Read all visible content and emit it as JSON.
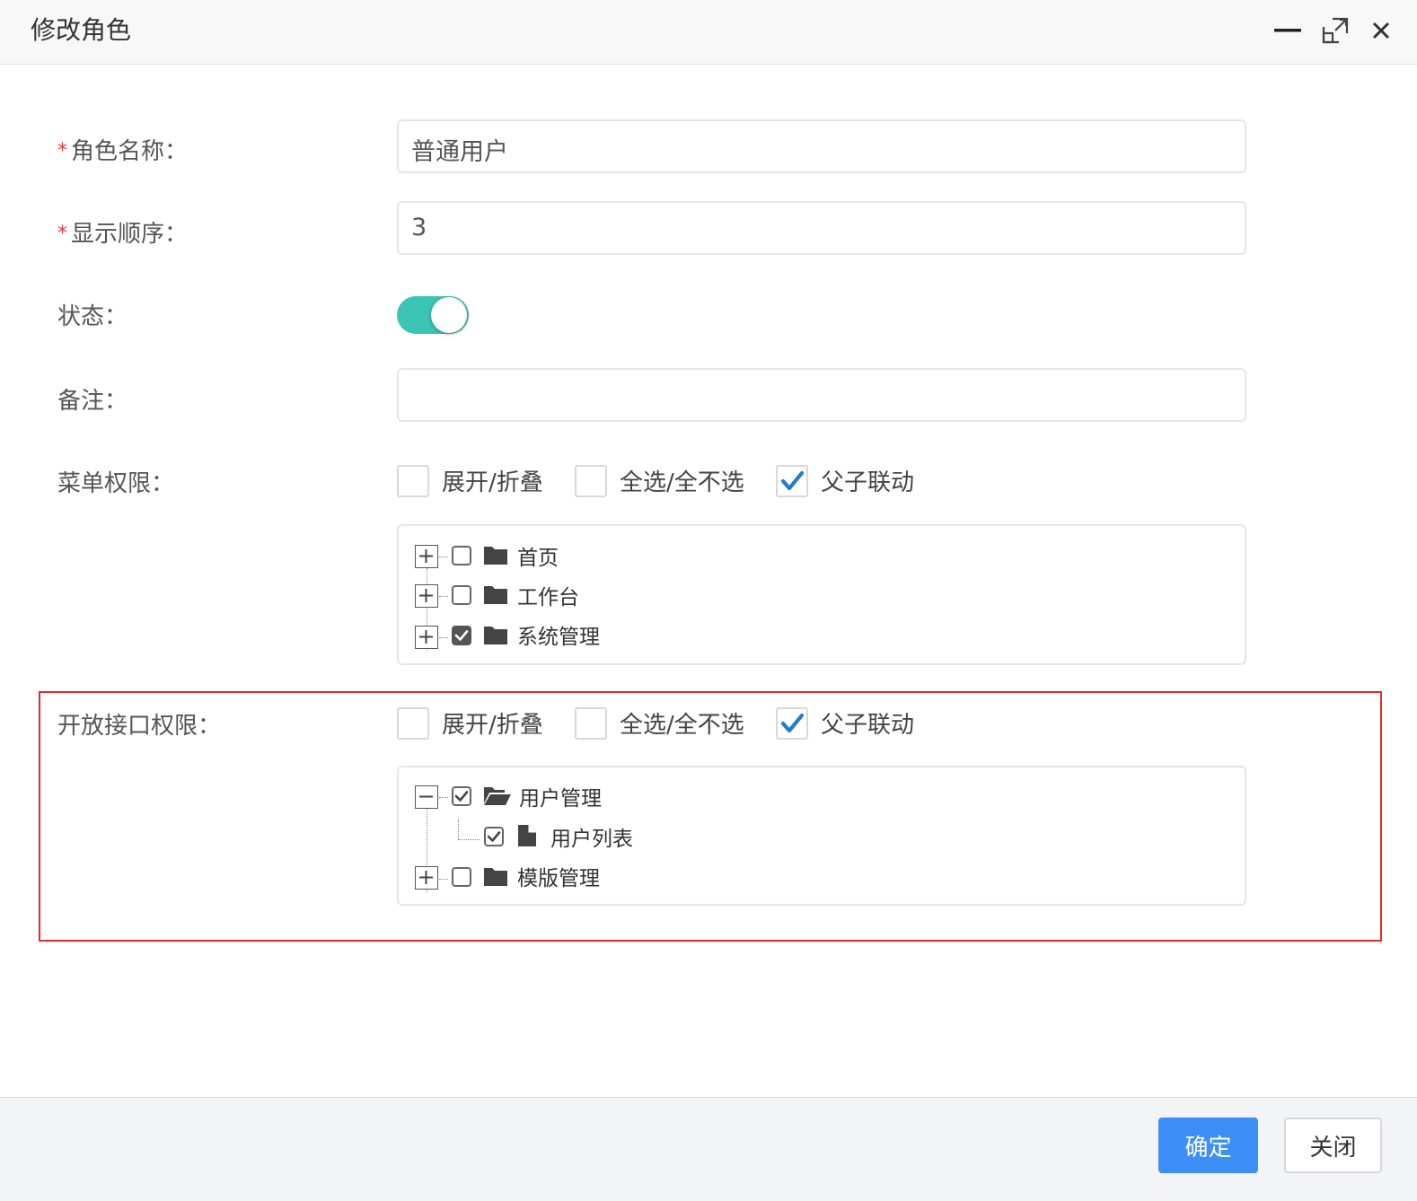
{
  "dialog": {
    "title": "修改角色",
    "controls": {
      "minimize": "minimize-icon",
      "maximize": "maximize-icon",
      "close": "close-icon"
    }
  },
  "form": {
    "role_name": {
      "label": "角色名称：",
      "required_mark": "*",
      "value": "普通用户"
    },
    "sort_order": {
      "label": "显示顺序：",
      "required_mark": "*",
      "value": "3"
    },
    "status": {
      "label": "状态：",
      "enabled": true
    },
    "remark": {
      "label": "备注：",
      "value": ""
    },
    "menu_perms": {
      "label": "菜单权限：",
      "options": [
        {
          "label": "展开/折叠",
          "checked": false
        },
        {
          "label": "全选/全不选",
          "checked": false
        },
        {
          "label": "父子联动",
          "checked": true
        }
      ],
      "tree": [
        {
          "label": "首页",
          "expanded": false,
          "checked": false
        },
        {
          "label": "工作台",
          "expanded": false,
          "checked": false
        },
        {
          "label": "系统管理",
          "expanded": false,
          "checked": true
        }
      ]
    },
    "api_perms": {
      "label": "开放接口权限：",
      "options": [
        {
          "label": "展开/折叠",
          "checked": false
        },
        {
          "label": "全选/全不选",
          "checked": false
        },
        {
          "label": "父子联动",
          "checked": true
        }
      ],
      "tree": [
        {
          "label": "用户管理",
          "expanded": true,
          "checked": true,
          "children": [
            {
              "label": "用户列表",
              "checked": true
            }
          ]
        },
        {
          "label": "模版管理",
          "expanded": false,
          "checked": false
        }
      ]
    }
  },
  "footer": {
    "confirm_label": "确定",
    "close_label": "关闭"
  },
  "colors": {
    "primary": "#3d8ef7",
    "switch_on": "#3cc4b4",
    "checkbox_check": "#1e7fc9",
    "highlight": "#e22a2a",
    "required": "#e4393c"
  }
}
